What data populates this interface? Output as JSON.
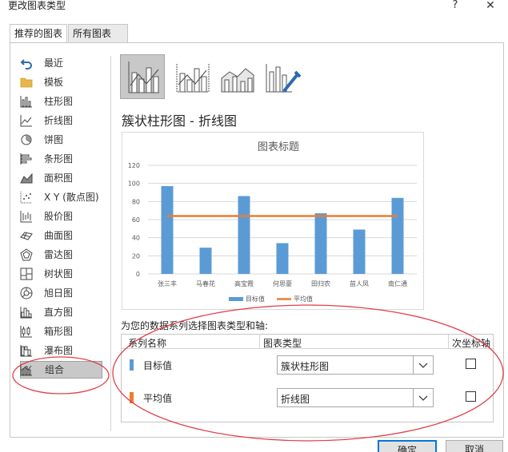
{
  "window": {
    "title": "更改图表类型",
    "help_glyph": "?",
    "close_glyph": "✕"
  },
  "tabs": [
    {
      "label": "推荐的图表",
      "selected": false
    },
    {
      "label": "所有图表",
      "selected": true
    }
  ],
  "sidebar": {
    "items": [
      {
        "label": "最近",
        "icon": "undo-icon"
      },
      {
        "label": "模板",
        "icon": "folder-icon"
      },
      {
        "label": "柱形图",
        "icon": "column-chart-icon"
      },
      {
        "label": "折线图",
        "icon": "line-chart-icon"
      },
      {
        "label": "饼图",
        "icon": "pie-chart-icon"
      },
      {
        "label": "条形图",
        "icon": "bar-chart-icon"
      },
      {
        "label": "面积图",
        "icon": "area-chart-icon"
      },
      {
        "label": "X Y (散点图)",
        "icon": "scatter-chart-icon"
      },
      {
        "label": "股价图",
        "icon": "stock-chart-icon"
      },
      {
        "label": "曲面图",
        "icon": "surface-chart-icon"
      },
      {
        "label": "雷达图",
        "icon": "radar-chart-icon"
      },
      {
        "label": "树状图",
        "icon": "treemap-chart-icon"
      },
      {
        "label": "旭日图",
        "icon": "sunburst-chart-icon"
      },
      {
        "label": "直方图",
        "icon": "histogram-chart-icon"
      },
      {
        "label": "箱形图",
        "icon": "box-whisker-chart-icon"
      },
      {
        "label": "瀑布图",
        "icon": "waterfall-chart-icon"
      },
      {
        "label": "组合",
        "icon": "combo-chart-icon",
        "selected": true
      }
    ]
  },
  "subtypes": [
    {
      "icon": "clustered-column-line-icon",
      "selected": true
    },
    {
      "icon": "clustered-column-line-secondary-axis-icon",
      "selected": false
    },
    {
      "icon": "stacked-area-clustered-column-icon",
      "selected": false
    },
    {
      "icon": "custom-combination-icon",
      "selected": false
    }
  ],
  "heading": "簇状柱形图 - 折线图",
  "chart_data": {
    "type": "bar",
    "title": "图表标题",
    "categories": [
      "张三丰",
      "马春花",
      "高宝霞",
      "何思豪",
      "田归农",
      "苗人凤",
      "南仁通"
    ],
    "series": [
      {
        "name": "目标值",
        "type": "bar",
        "color": "#5b9bd5",
        "values": [
          97,
          29,
          86,
          34,
          67,
          49,
          84
        ]
      },
      {
        "name": "平均值",
        "type": "line",
        "color": "#ed7d31",
        "values": [
          64,
          64,
          64,
          64,
          64,
          64,
          64
        ]
      }
    ],
    "ylim": [
      0,
      120
    ],
    "yticks": [
      "0",
      "20",
      "40",
      "60",
      "80",
      "100",
      "120"
    ],
    "grid": true,
    "legend": "bottom"
  },
  "assign": {
    "label": "为您的数据系列选择图表类型和轴:",
    "headers": {
      "series_name": "系列名称",
      "chart_type": "图表类型",
      "secondary_axis": "次坐标轴"
    },
    "rows": [
      {
        "name": "目标值",
        "color": "#5b9bd5",
        "chart_type": "簇状柱形图",
        "secondary": false
      },
      {
        "name": "平均值",
        "color": "#ed7d31",
        "chart_type": "折线图",
        "secondary": false
      }
    ]
  },
  "buttons": {
    "ok": "确定",
    "cancel": "取消"
  },
  "annotation_color": "#e0404a"
}
